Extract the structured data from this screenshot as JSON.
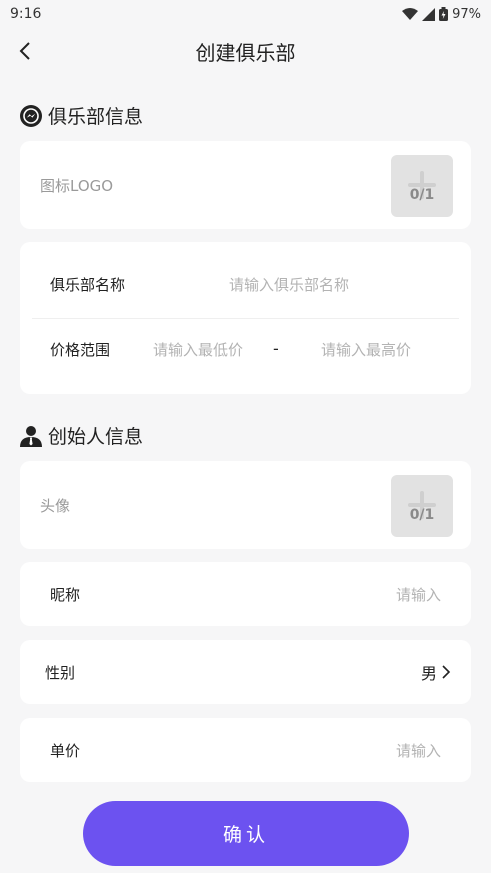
{
  "status_bar": {
    "time": "9:16",
    "battery": "97%"
  },
  "nav": {
    "title": "创建俱乐部"
  },
  "club_section": {
    "title": "俱乐部信息",
    "logo_label": "图标LOGO",
    "logo_count": "0/1",
    "name_label": "俱乐部名称",
    "name_placeholder": "请输入俱乐部名称",
    "price_label": "价格范围",
    "price_min_placeholder": "请输入最低价",
    "price_separator": "-",
    "price_max_placeholder": "请输入最高价"
  },
  "founder_section": {
    "title": "创始人信息",
    "avatar_label": "头像",
    "avatar_count": "0/1",
    "nickname_label": "昵称",
    "nickname_placeholder": "请输入",
    "gender_label": "性别",
    "gender_value": "男",
    "unit_price_label": "单价",
    "unit_price_placeholder": "请输入"
  },
  "confirm_label": "确认",
  "colors": {
    "accent": "#6c52f0",
    "background": "#f6f6f7"
  }
}
